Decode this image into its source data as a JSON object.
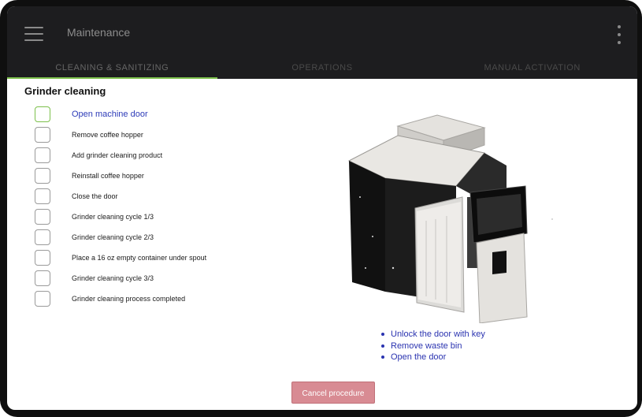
{
  "appbar": {
    "title": "Maintenance",
    "menu_icon": "hamburger-menu-icon",
    "more_icon": "more-vertical-icon"
  },
  "tabs": [
    {
      "label": "CLEANING & SANITIZING",
      "active": true
    },
    {
      "label": "OPERATIONS",
      "active": false
    },
    {
      "label": "MANUAL ACTIVATION",
      "active": false
    }
  ],
  "section": {
    "title": "Grinder cleaning"
  },
  "steps": [
    {
      "label": "Open machine door",
      "current": true,
      "checked": false
    },
    {
      "label": "Remove coffee hopper",
      "current": false,
      "checked": false
    },
    {
      "label": "Add grinder cleaning product",
      "current": false,
      "checked": false
    },
    {
      "label": "Reinstall coffee hopper",
      "current": false,
      "checked": false
    },
    {
      "label": "Close the door",
      "current": false,
      "checked": false
    },
    {
      "label": "Grinder cleaning cycle 1/3",
      "current": false,
      "checked": false
    },
    {
      "label": "Grinder cleaning cycle 2/3",
      "current": false,
      "checked": false
    },
    {
      "label": "Place a 16 oz empty container under spout",
      "current": false,
      "checked": false
    },
    {
      "label": "Grinder cleaning cycle 3/3",
      "current": false,
      "checked": false
    },
    {
      "label": "Grinder cleaning process completed",
      "current": false,
      "checked": false
    }
  ],
  "instructions": [
    "Unlock the door with key",
    "Remove waste bin",
    "Open the door"
  ],
  "cancel_button": {
    "label": "Cancel procedure"
  },
  "colors": {
    "appbar_bg": "#1d1d1f",
    "active_tab_indicator": "#7cc04b",
    "current_step_text": "#2d3bb8",
    "instruction_text": "#2a33b0",
    "cancel_button_bg": "#d88b93"
  }
}
